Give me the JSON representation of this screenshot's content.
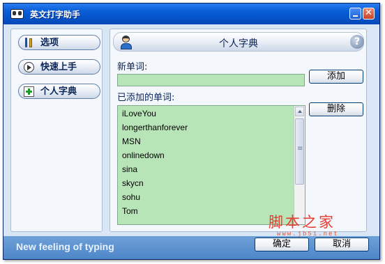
{
  "window": {
    "title": "英文打字助手"
  },
  "titlebar_buttons": {
    "minimize": "",
    "close": "✕"
  },
  "sidebar": {
    "items": [
      {
        "label": "选项",
        "icon": "tools-icon"
      },
      {
        "label": "快速上手",
        "icon": "play-icon"
      },
      {
        "label": "个人字典",
        "icon": "add-dictionary-icon"
      }
    ]
  },
  "panel": {
    "title": "个人字典",
    "help": "?",
    "new_word_label": "新单词:",
    "new_word_value": "",
    "add_button": "添加",
    "added_words_label": "已添加的单词:",
    "delete_button": "删除",
    "words": [
      "iLoveYou",
      "longerthanforever",
      "MSN",
      "onlinedown",
      "sina",
      "skycn",
      "sohu",
      "Tom"
    ]
  },
  "footer": {
    "slogan": "New feeling of typing",
    "ok_button": "确定",
    "cancel_button": "取消"
  },
  "watermark": {
    "text": "脚本之家",
    "url": "www.jb51.net"
  },
  "colors": {
    "titlebar": "#0552c8",
    "list_bg": "#b8e5b8",
    "footer": "#5b8fce",
    "watermark": "#e63b2e"
  }
}
